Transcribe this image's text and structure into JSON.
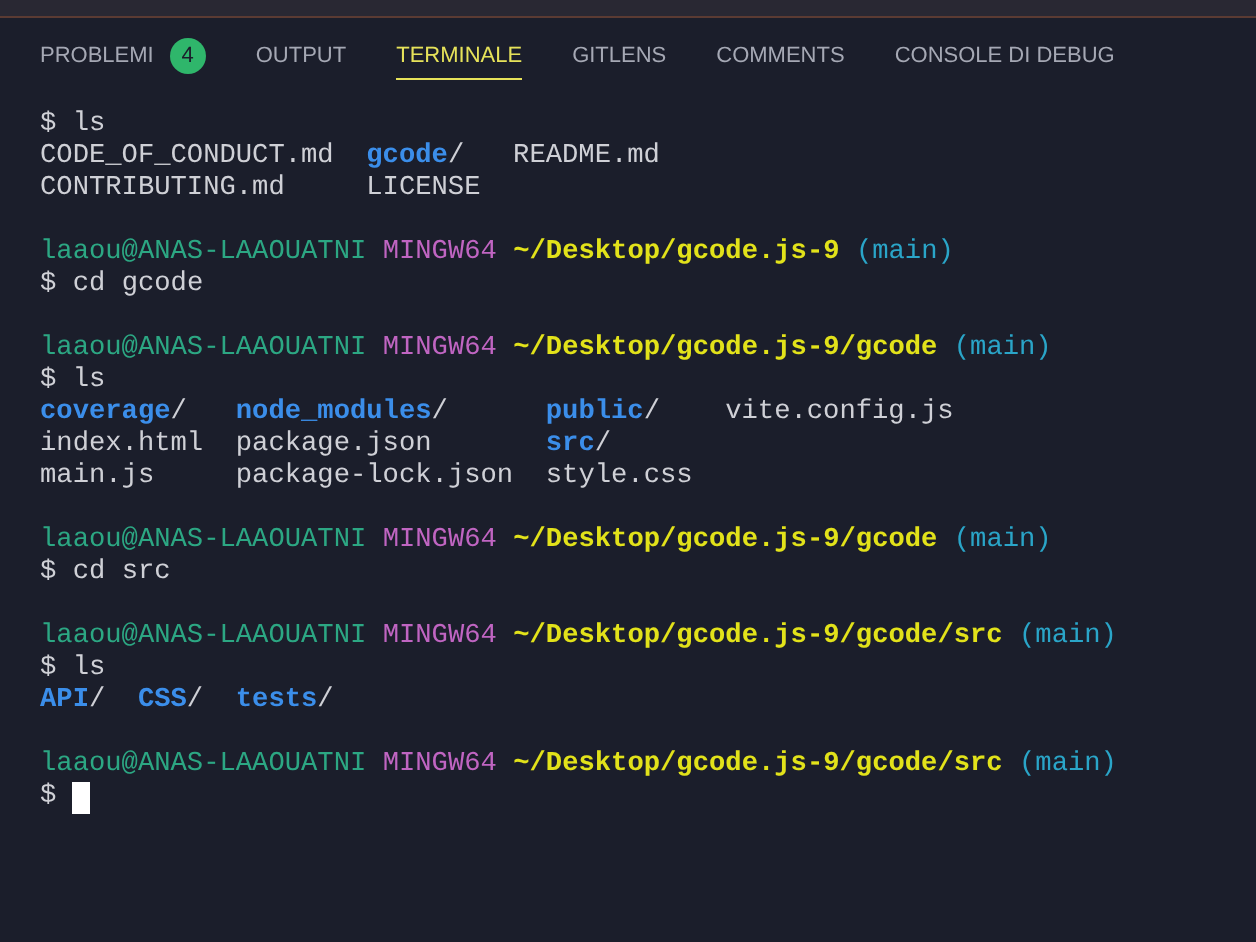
{
  "tabs": [
    {
      "label": "PROBLEMI",
      "selected": false,
      "badge": "4"
    },
    {
      "label": "OUTPUT",
      "selected": false
    },
    {
      "label": "TERMINALE",
      "selected": true
    },
    {
      "label": "GITLENS",
      "selected": false
    },
    {
      "label": "COMMENTS",
      "selected": false
    },
    {
      "label": "CONSOLE DI DEBUG",
      "selected": false
    }
  ],
  "terminal": [
    {
      "kind": "command",
      "prompt": "$",
      "text": "ls"
    },
    {
      "kind": "listing",
      "rows": [
        [
          {
            "name": "CODE_OF_CONDUCT.md",
            "kind": "file"
          },
          {
            "name": "gcode/",
            "kind": "dir"
          },
          {
            "name": "README.md",
            "kind": "file"
          }
        ],
        [
          {
            "name": "CONTRIBUTING.md",
            "kind": "file"
          },
          {
            "name": "LICENSE",
            "kind": "file"
          }
        ]
      ]
    },
    {
      "kind": "blank"
    },
    {
      "kind": "prompt",
      "user": "laaou@ANAS-LAAOUATNI",
      "host": "MINGW64",
      "path": "~/Desktop/gcode.js-9",
      "branch": "(main)"
    },
    {
      "kind": "command",
      "prompt": "$",
      "text": "cd gcode"
    },
    {
      "kind": "blank"
    },
    {
      "kind": "prompt",
      "user": "laaou@ANAS-LAAOUATNI",
      "host": "MINGW64",
      "path": "~/Desktop/gcode.js-9/gcode",
      "branch": "(main)"
    },
    {
      "kind": "command",
      "prompt": "$",
      "text": "ls"
    },
    {
      "kind": "listing",
      "rows": [
        [
          {
            "name": "coverage/",
            "kind": "dir"
          },
          {
            "name": "node_modules/",
            "kind": "dir"
          },
          {
            "name": "public/",
            "kind": "dir"
          },
          {
            "name": "vite.config.js",
            "kind": "file"
          }
        ],
        [
          {
            "name": "index.html",
            "kind": "file"
          },
          {
            "name": "package.json",
            "kind": "file"
          },
          {
            "name": "src/",
            "kind": "dir"
          }
        ],
        [
          {
            "name": "main.js",
            "kind": "file"
          },
          {
            "name": "package-lock.json",
            "kind": "file"
          },
          {
            "name": "style.css",
            "kind": "file"
          }
        ]
      ]
    },
    {
      "kind": "blank"
    },
    {
      "kind": "prompt",
      "user": "laaou@ANAS-LAAOUATNI",
      "host": "MINGW64",
      "path": "~/Desktop/gcode.js-9/gcode",
      "branch": "(main)"
    },
    {
      "kind": "command",
      "prompt": "$",
      "text": "cd src"
    },
    {
      "kind": "blank"
    },
    {
      "kind": "prompt",
      "user": "laaou@ANAS-LAAOUATNI",
      "host": "MINGW64",
      "path": "~/Desktop/gcode.js-9/gcode/src",
      "branch": "(main)"
    },
    {
      "kind": "command",
      "prompt": "$",
      "text": "ls"
    },
    {
      "kind": "listing",
      "rows": [
        [
          {
            "name": "API/",
            "kind": "dir"
          },
          {
            "name": "CSS/",
            "kind": "dir"
          },
          {
            "name": "tests/",
            "kind": "dir"
          }
        ]
      ]
    },
    {
      "kind": "blank"
    },
    {
      "kind": "prompt",
      "user": "laaou@ANAS-LAAOUATNI",
      "host": "MINGW64",
      "path": "~/Desktop/gcode.js-9/gcode/src",
      "branch": "(main)"
    },
    {
      "kind": "command",
      "prompt": "$",
      "cursor": true
    }
  ]
}
